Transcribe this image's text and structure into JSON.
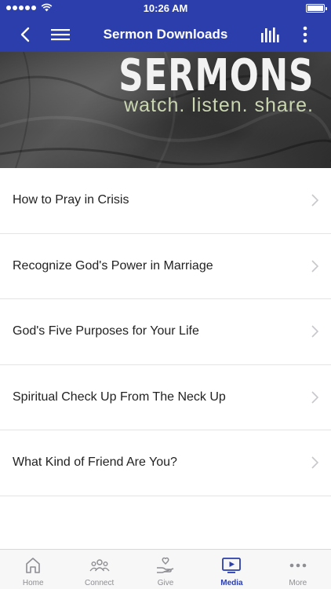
{
  "status_bar": {
    "time": "10:26 AM"
  },
  "nav": {
    "title": "Sermon Downloads"
  },
  "banner": {
    "title": "SERMONS",
    "tagline": "watch. listen. share."
  },
  "sermons": [
    {
      "label": "How to Pray in Crisis"
    },
    {
      "label": "Recognize God's Power in Marriage"
    },
    {
      "label": "God's Five Purposes for Your Life"
    },
    {
      "label": "Spiritual Check Up From The Neck Up"
    },
    {
      "label": "What Kind of Friend Are You?"
    }
  ],
  "tabs": [
    {
      "label": "Home",
      "icon": "home-icon",
      "active": false
    },
    {
      "label": "Connect",
      "icon": "people-icon",
      "active": false
    },
    {
      "label": "Give",
      "icon": "give-hand-icon",
      "active": false
    },
    {
      "label": "Media",
      "icon": "media-icon",
      "active": true
    },
    {
      "label": "More",
      "icon": "more-icon",
      "active": false
    }
  ],
  "colors": {
    "accent": "#2b3eab",
    "inactive": "#8e8e93"
  }
}
